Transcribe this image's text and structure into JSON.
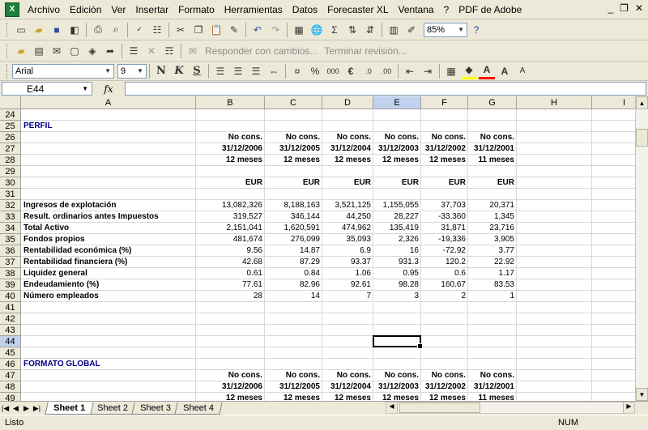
{
  "menu": {
    "items": [
      "Archivo",
      "Edición",
      "Ver",
      "Insertar",
      "Formato",
      "Herramientas",
      "Datos",
      "Forecaster XL",
      "Ventana",
      "?",
      "PDF de Adobe"
    ],
    "window_controls": [
      "_",
      "❐",
      "✕"
    ]
  },
  "toolbar": {
    "zoom": "85%",
    "review_reply": "Responder con cambios...",
    "review_end": "Terminar revisión...",
    "font_name": "Arial",
    "font_size": "9",
    "bold": "N",
    "italic": "K",
    "underline": "S",
    "percent": "%",
    "thousands": "000",
    "euro": "€"
  },
  "formula_bar": {
    "name_box": "E44",
    "fx": "fx",
    "content": ""
  },
  "columns": [
    "A",
    "B",
    "C",
    "D",
    "E",
    "F",
    "G",
    "H",
    "I"
  ],
  "selected_column": "E",
  "selected_row": "44",
  "rows": [
    {
      "n": "24",
      "cells": {}
    },
    {
      "n": "25",
      "cells": {
        "A": "PERFIL"
      }
    },
    {
      "n": "26",
      "cells": {
        "B": "No cons.",
        "C": "No cons.",
        "D": "No cons.",
        "E": "No cons.",
        "F": "No cons.",
        "G": "No cons."
      }
    },
    {
      "n": "27",
      "cells": {
        "B": "31/12/2006",
        "C": "31/12/2005",
        "D": "31/12/2004",
        "E": "31/12/2003",
        "F": "31/12/2002",
        "G": "31/12/2001"
      }
    },
    {
      "n": "28",
      "cells": {
        "B": "12 meses",
        "C": "12 meses",
        "D": "12 meses",
        "E": "12 meses",
        "F": "12 meses",
        "G": "11 meses"
      }
    },
    {
      "n": "29",
      "cells": {}
    },
    {
      "n": "30",
      "cells": {
        "B": "EUR",
        "C": "EUR",
        "D": "EUR",
        "E": "EUR",
        "F": "EUR",
        "G": "EUR"
      }
    },
    {
      "n": "31",
      "cells": {}
    },
    {
      "n": "32",
      "cells": {
        "A": "Ingresos de explotación",
        "B": "13,082,326",
        "C": "8,188,163",
        "D": "3,521,125",
        "E": "1,155,055",
        "F": "37,703",
        "G": "20,371"
      }
    },
    {
      "n": "33",
      "cells": {
        "A": "Result. ordinarios antes Impuestos",
        "B": "319,527",
        "C": "346,144",
        "D": "44,250",
        "E": "28,227",
        "F": "-33,360",
        "G": "1,345"
      }
    },
    {
      "n": "34",
      "cells": {
        "A": "Total Activo",
        "B": "2,151,041",
        "C": "1,620,591",
        "D": "474,962",
        "E": "135,419",
        "F": "31,871",
        "G": "23,716"
      }
    },
    {
      "n": "35",
      "cells": {
        "A": "Fondos propios",
        "B": "481,674",
        "C": "276,099",
        "D": "35,093",
        "E": "2,326",
        "F": "-19,336",
        "G": "3,905"
      }
    },
    {
      "n": "36",
      "cells": {
        "A": "Rentabilidad económica (%)",
        "B": "9.56",
        "C": "14.87",
        "D": "6.9",
        "E": "16",
        "F": "-72.92",
        "G": "3.77"
      }
    },
    {
      "n": "37",
      "cells": {
        "A": "Rentabilidad financiera (%)",
        "B": "42.68",
        "C": "87.29",
        "D": "93.37",
        "E": "931.3",
        "F": "120.2",
        "G": "22.92"
      }
    },
    {
      "n": "38",
      "cells": {
        "A": "Liquidez general",
        "B": "0.61",
        "C": "0.84",
        "D": "1.06",
        "E": "0.95",
        "F": "0.6",
        "G": "1.17"
      }
    },
    {
      "n": "39",
      "cells": {
        "A": "Endeudamiento (%)",
        "B": "77.61",
        "C": "82.96",
        "D": "92.61",
        "E": "98.28",
        "F": "160.67",
        "G": "83.53"
      }
    },
    {
      "n": "40",
      "cells": {
        "A": "Número empleados",
        "B": "28",
        "C": "14",
        "D": "7",
        "E": "3",
        "F": "2",
        "G": "1"
      }
    },
    {
      "n": "41",
      "cells": {}
    },
    {
      "n": "42",
      "cells": {}
    },
    {
      "n": "43",
      "cells": {}
    },
    {
      "n": "44",
      "cells": {}
    },
    {
      "n": "45",
      "cells": {}
    },
    {
      "n": "46",
      "cells": {
        "A": "FORMATO GLOBAL"
      }
    },
    {
      "n": "47",
      "cells": {
        "B": "No cons.",
        "C": "No cons.",
        "D": "No cons.",
        "E": "No cons.",
        "F": "No cons.",
        "G": "No cons."
      }
    },
    {
      "n": "48",
      "cells": {
        "B": "31/12/2006",
        "C": "31/12/2005",
        "D": "31/12/2004",
        "E": "31/12/2003",
        "F": "31/12/2002",
        "G": "31/12/2001"
      }
    },
    {
      "n": "49",
      "cells": {
        "B": "12 meses",
        "C": "12 meses",
        "D": "12 meses",
        "E": "12 meses",
        "F": "12 meses",
        "G": "11 meses"
      }
    }
  ],
  "sheets": [
    "Sheet 1",
    "Sheet 2",
    "Sheet 3",
    "Sheet 4"
  ],
  "active_sheet": "Sheet 1",
  "status": {
    "left": "Listo",
    "num": "NUM"
  },
  "colors": {
    "heading_blue": "#000080",
    "selected_header": "#c1d2ee",
    "chrome": "#ece9d8"
  }
}
